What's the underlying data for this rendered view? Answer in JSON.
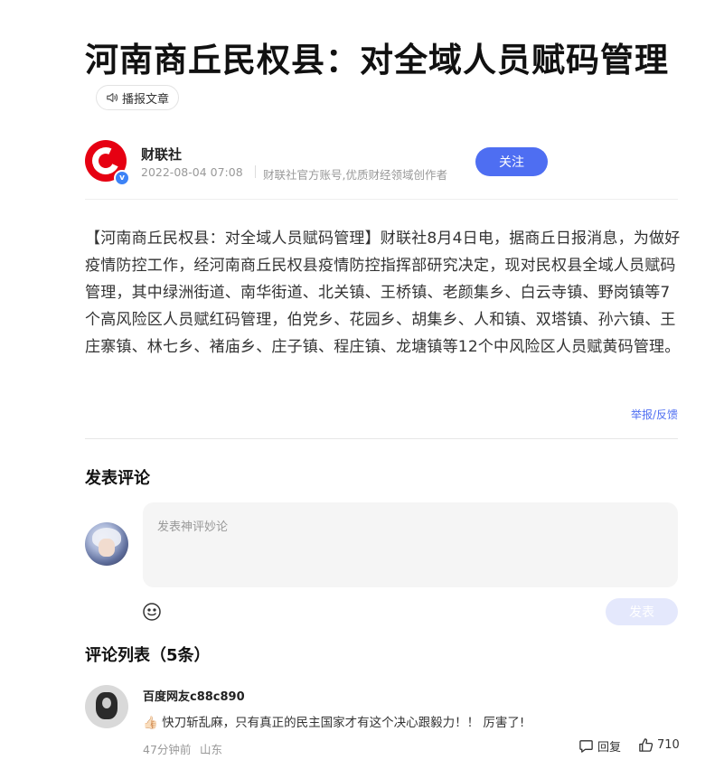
{
  "article": {
    "title": "河南商丘民权县：对全域人员赋码管理",
    "listen_label": "播报文章",
    "author": "财联社",
    "date": "2022-08-04 07:08",
    "author_desc": "财联社官方账号,优质财经领域创作者",
    "follow_label": "关注",
    "body": "【河南商丘民权县：对全域人员赋码管理】财联社8月4日电，据商丘日报消息，为做好疫情防控工作，经河南商丘民权县疫情防控指挥部研究决定，现对民权县全域人员赋码管理，其中绿洲街道、南华街道、北关镇、王桥镇、老颜集乡、白云寺镇、野岗镇等7个高风险区人员赋红码管理，伯党乡、花园乡、胡集乡、人和镇、双塔镇、孙六镇、王庄寨镇、林七乡、褚庙乡、庄子镇、程庄镇、龙塘镇等12个中风险区人员赋黄码管理。",
    "report_label": "举报/反馈"
  },
  "comment_form": {
    "heading": "发表评论",
    "placeholder": "发表神评妙论",
    "send_label": "发表"
  },
  "comments": {
    "heading": "评论列表（5条）",
    "items": [
      {
        "user": "百度网友c88c890",
        "text": "👍🏻 快刀斩乱麻，只有真正的民主国家才有这个决心跟毅力！！ 厉害了!",
        "time": "47分钟前",
        "location": "山东",
        "reply_label": "回复",
        "likes": "710"
      }
    ]
  },
  "colors": {
    "accent": "#4e6ef2",
    "brand": "#e60012"
  }
}
